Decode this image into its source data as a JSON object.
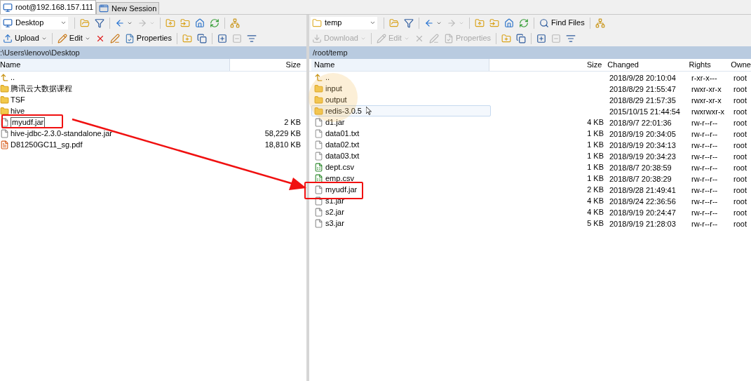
{
  "tabs": [
    {
      "label": "root@192.168.157.111",
      "selected": true
    },
    {
      "label": "New Session",
      "selected": false
    }
  ],
  "left": {
    "toolbar_1": [
      {
        "kind": "location",
        "label": "Desktop"
      },
      {
        "kind": "separator"
      },
      {
        "kind": "open",
        "disabled": false
      },
      {
        "kind": "filter",
        "disabled": false
      },
      {
        "kind": "separator"
      },
      {
        "kind": "back",
        "disabled": false
      },
      {
        "kind": "forward",
        "disabled": true
      },
      {
        "kind": "separator"
      },
      {
        "kind": "parent",
        "disabled": false
      },
      {
        "kind": "root",
        "disabled": false
      },
      {
        "kind": "home",
        "disabled": false
      },
      {
        "kind": "refresh",
        "disabled": false
      },
      {
        "kind": "separator"
      },
      {
        "kind": "tree",
        "disabled": false
      }
    ],
    "toolbar_2": [
      {
        "kind": "upload",
        "label": "Upload",
        "disabled": false
      },
      {
        "kind": "separator"
      },
      {
        "kind": "edit",
        "label": "Edit",
        "disabled": false
      },
      {
        "kind": "delete",
        "disabled": false
      },
      {
        "kind": "rename",
        "disabled": false
      },
      {
        "kind": "properties",
        "label": "Properties",
        "disabled": false
      },
      {
        "kind": "separator"
      },
      {
        "kind": "newfolder",
        "disabled": false
      },
      {
        "kind": "copy",
        "disabled": false
      },
      {
        "kind": "separator"
      },
      {
        "kind": "add",
        "disabled": false
      },
      {
        "kind": "remove",
        "disabled": true
      },
      {
        "kind": "select",
        "disabled": false
      }
    ],
    "path": ":\\Users\\lenovo\\Desktop",
    "columns": [
      "Name",
      "Size"
    ],
    "rows": [
      {
        "name": "..",
        "size": "",
        "kind": "parent",
        "renaming": false
      },
      {
        "name": "腾讯云大数据课程",
        "size": "",
        "kind": "folder",
        "renaming": false
      },
      {
        "name": "TSF",
        "size": "",
        "kind": "folder",
        "renaming": false
      },
      {
        "name": "hive",
        "size": "",
        "kind": "folder",
        "renaming": false
      },
      {
        "name": "myudf.jar",
        "size": "2 KB",
        "kind": "jar",
        "renaming": true
      },
      {
        "name": "hive-jdbc-2.3.0-standalone.jar",
        "size": "58,229 KB",
        "kind": "jar",
        "renaming": false
      },
      {
        "name": "D81250GC11_sg.pdf",
        "size": "18,810 KB",
        "kind": "pdf",
        "renaming": false
      }
    ]
  },
  "right": {
    "toolbar_1": [
      {
        "kind": "location",
        "label": "temp"
      },
      {
        "kind": "separator"
      },
      {
        "kind": "open",
        "disabled": false
      },
      {
        "kind": "filter",
        "disabled": false
      },
      {
        "kind": "separator"
      },
      {
        "kind": "back",
        "disabled": false
      },
      {
        "kind": "forward",
        "disabled": true
      },
      {
        "kind": "separator"
      },
      {
        "kind": "parent",
        "disabled": false
      },
      {
        "kind": "root",
        "disabled": false
      },
      {
        "kind": "home",
        "disabled": false
      },
      {
        "kind": "refresh",
        "disabled": false
      },
      {
        "kind": "separator"
      },
      {
        "kind": "find",
        "label": "Find Files",
        "disabled": false
      },
      {
        "kind": "separator"
      },
      {
        "kind": "tree",
        "disabled": false
      }
    ],
    "toolbar_2": [
      {
        "kind": "download",
        "label": "Download",
        "disabled": true
      },
      {
        "kind": "separator"
      },
      {
        "kind": "edit",
        "label": "Edit",
        "disabled": true
      },
      {
        "kind": "delete",
        "disabled": true
      },
      {
        "kind": "rename",
        "disabled": true
      },
      {
        "kind": "properties",
        "label": "Properties",
        "disabled": true
      },
      {
        "kind": "separator"
      },
      {
        "kind": "newfolder",
        "disabled": false
      },
      {
        "kind": "copy",
        "disabled": false
      },
      {
        "kind": "separator"
      },
      {
        "kind": "add",
        "disabled": false
      },
      {
        "kind": "remove",
        "disabled": true
      },
      {
        "kind": "select",
        "disabled": false
      }
    ],
    "path": "/root/temp",
    "columns": [
      "Name",
      "Size",
      "Changed",
      "Rights",
      "Owne"
    ],
    "rows": [
      {
        "name": "..",
        "size": "",
        "changed": "2018/9/28 20:10:04",
        "rights": "r-xr-x---",
        "owner": "root",
        "kind": "parent",
        "hovered": false
      },
      {
        "name": "input",
        "size": "",
        "changed": "2018/8/29 21:55:47",
        "rights": "rwxr-xr-x",
        "owner": "root",
        "kind": "folder",
        "hovered": false
      },
      {
        "name": "output",
        "size": "",
        "changed": "2018/8/29 21:57:35",
        "rights": "rwxr-xr-x",
        "owner": "root",
        "kind": "folder",
        "hovered": false
      },
      {
        "name": "redis-3.0.5",
        "size": "",
        "changed": "2015/10/15 21:44:54",
        "rights": "rwxrwxr-x",
        "owner": "root",
        "kind": "folder",
        "hovered": true
      },
      {
        "name": "d1.jar",
        "size": "4 KB",
        "changed": "2018/9/7 22:01:36",
        "rights": "rw-r--r--",
        "owner": "root",
        "kind": "jar",
        "hovered": false
      },
      {
        "name": "data01.txt",
        "size": "1 KB",
        "changed": "2018/9/19 20:34:05",
        "rights": "rw-r--r--",
        "owner": "root",
        "kind": "text",
        "hovered": false
      },
      {
        "name": "data02.txt",
        "size": "1 KB",
        "changed": "2018/9/19 20:34:13",
        "rights": "rw-r--r--",
        "owner": "root",
        "kind": "text",
        "hovered": false
      },
      {
        "name": "data03.txt",
        "size": "1 KB",
        "changed": "2018/9/19 20:34:23",
        "rights": "rw-r--r--",
        "owner": "root",
        "kind": "text",
        "hovered": false
      },
      {
        "name": "dept.csv",
        "size": "1 KB",
        "changed": "2018/8/7 20:38:59",
        "rights": "rw-r--r--",
        "owner": "root",
        "kind": "csv",
        "hovered": false
      },
      {
        "name": "emp.csv",
        "size": "1 KB",
        "changed": "2018/8/7 20:38:29",
        "rights": "rw-r--r--",
        "owner": "root",
        "kind": "csv",
        "hovered": false
      },
      {
        "name": "myudf.jar",
        "size": "2 KB",
        "changed": "2018/9/28 21:49:41",
        "rights": "rw-r--r--",
        "owner": "root",
        "kind": "jar",
        "hovered": false
      },
      {
        "name": "s1.jar",
        "size": "4 KB",
        "changed": "2018/9/24 22:36:56",
        "rights": "rw-r--r--",
        "owner": "root",
        "kind": "jar",
        "hovered": false
      },
      {
        "name": "s2.jar",
        "size": "4 KB",
        "changed": "2018/9/19 20:24:47",
        "rights": "rw-r--r--",
        "owner": "root",
        "kind": "jar",
        "hovered": false
      },
      {
        "name": "s3.jar",
        "size": "5 KB",
        "changed": "2018/9/19 21:28:03",
        "rights": "rw-r--r--",
        "owner": "root",
        "kind": "jar",
        "hovered": false
      }
    ]
  }
}
